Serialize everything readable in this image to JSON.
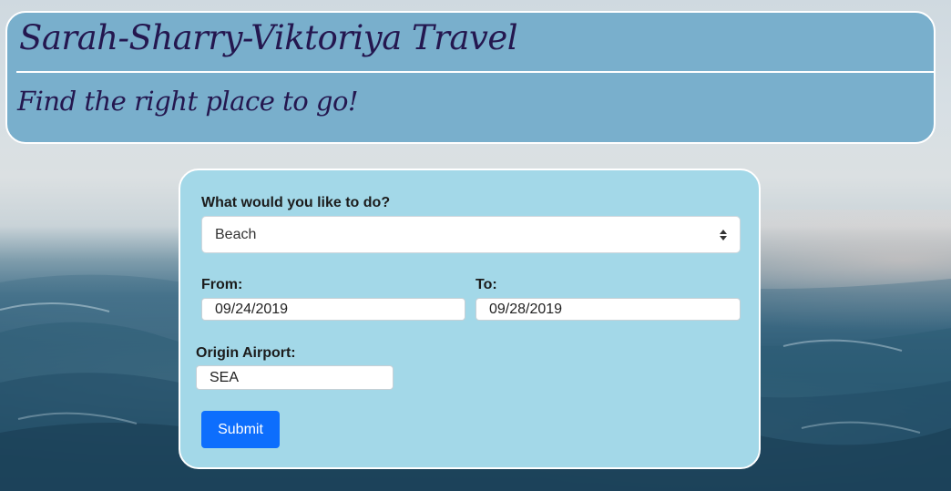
{
  "header": {
    "title": "Sarah-Sharry-Viktoriya Travel",
    "tagline": "Find the right place to go!"
  },
  "form": {
    "activity_label": "What would you like to do?",
    "activity_value": "Beach",
    "from_label": "From:",
    "from_value": "09/24/2019",
    "to_label": "To:",
    "to_value": "09/28/2019",
    "origin_label": "Origin Airport:",
    "origin_value": "SEA",
    "submit_label": "Submit"
  },
  "colors": {
    "header_bg": "#79afcc",
    "card_bg": "#a3d8e8",
    "title_text": "#24174f",
    "button": "#0d6efd"
  }
}
